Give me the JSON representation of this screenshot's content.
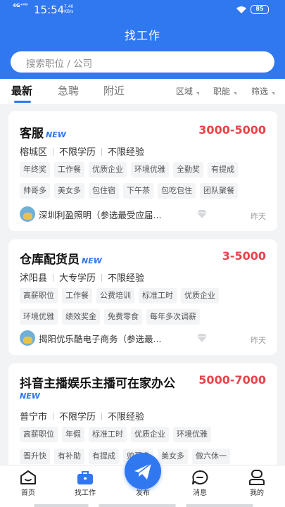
{
  "status_bar": {
    "network": "4G⁺ᴴᴰ",
    "time": "15:54",
    "speed_value": "7.40",
    "speed_unit": "KB/s",
    "battery": "85"
  },
  "header": {
    "title": "找工作",
    "search_placeholder": "搜索职位 / 公司"
  },
  "tabs": [
    {
      "label": "最新"
    },
    {
      "label": "急聘"
    },
    {
      "label": "附近"
    }
  ],
  "filters": [
    {
      "label": "区域"
    },
    {
      "label": "职能"
    },
    {
      "label": "筛选"
    }
  ],
  "jobs": [
    {
      "title": "客服",
      "badge": "NEW",
      "salary": "3000-5000",
      "location": "榕城区",
      "education": "不限学历",
      "experience": "不限经验",
      "tags_row1": [
        "年终奖",
        "工作餐",
        "优质企业",
        "环境优雅",
        "全勤奖",
        "有提成"
      ],
      "tags_row2": [
        "帅哥多",
        "美女多",
        "包住宿",
        "下午茶",
        "包吃包住",
        "团队聚餐"
      ],
      "company": "深圳利盈照明（参选最受应届...",
      "time": "昨天"
    },
    {
      "title": "仓库配货员",
      "badge": "NEW",
      "salary": "3-5000",
      "location": "沭阳县",
      "education": "大专学历",
      "experience": "不限经验",
      "tags_row1": [
        "高薪职位",
        "工作餐",
        "公费培训",
        "标准工时",
        "优质企业"
      ],
      "tags_row2": [
        "环境优雅",
        "绩效奖金",
        "免费零食",
        "每年多次调薪"
      ],
      "company": "揭阳优乐酷电子商务（参选最...",
      "time": "昨天"
    },
    {
      "title": "抖音主播娱乐主播可在家办公",
      "badge": "NEW",
      "salary": "5000-7000",
      "location": "普宁市",
      "education": "不限学历",
      "experience": "不限经验",
      "tags_row1": [
        "高薪职位",
        "年假",
        "标准工时",
        "优质企业",
        "环境优雅"
      ],
      "tags_row2": [
        "晋升快",
        "有补助",
        "有提成",
        "帅哥多",
        "美女多",
        "做六休一"
      ]
    }
  ],
  "bottom_nav": [
    {
      "label": "首页"
    },
    {
      "label": "找工作"
    },
    {
      "label": "发布"
    },
    {
      "label": "消息"
    },
    {
      "label": "我的"
    }
  ],
  "colors": {
    "primary": "#2f78f0",
    "salary": "#e8434b",
    "background": "#f2f3f5"
  }
}
